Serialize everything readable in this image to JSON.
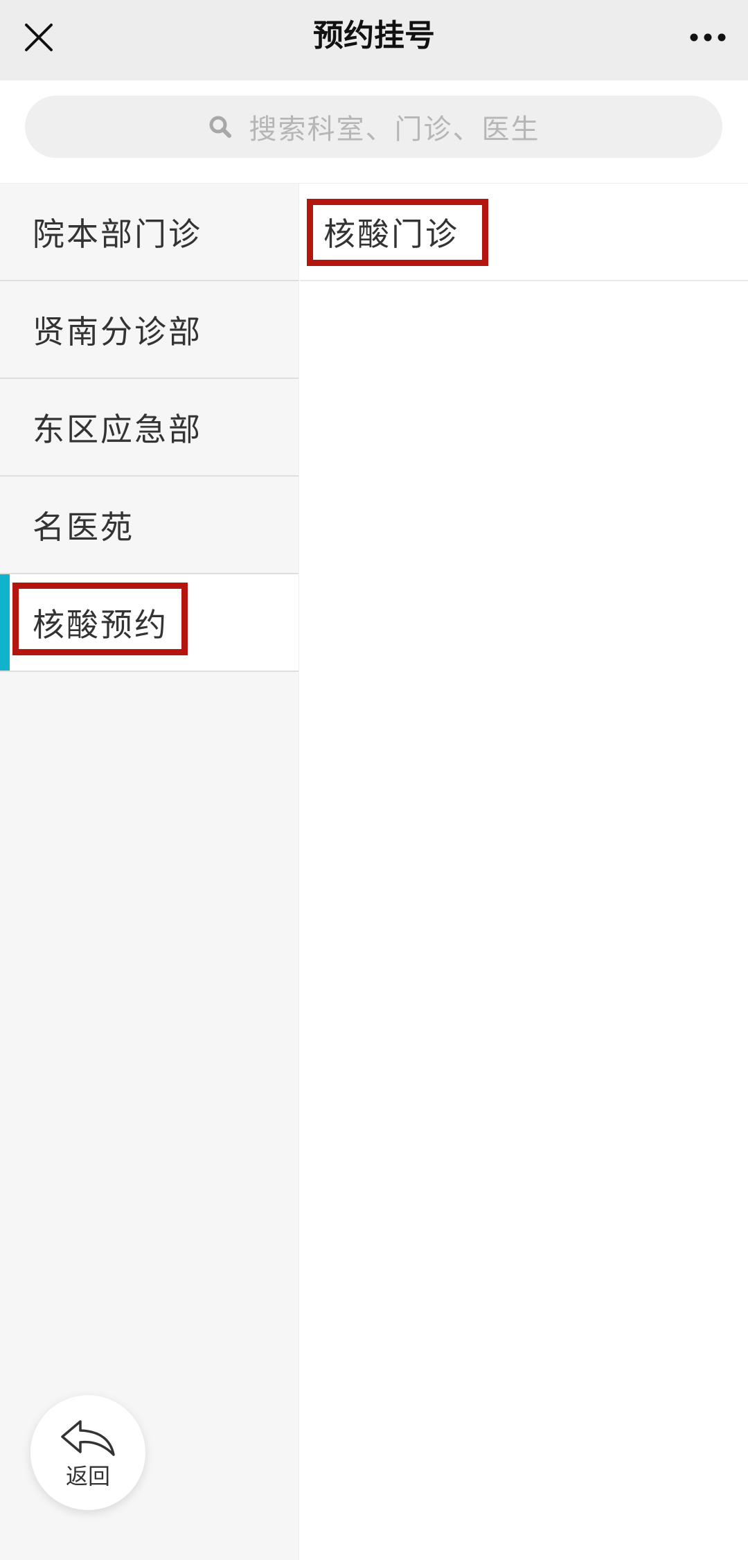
{
  "header": {
    "title": "预约挂号",
    "close_icon": "close-icon",
    "more_icon": "more-dots-icon"
  },
  "search": {
    "placeholder": "搜索科室、门诊、医生",
    "icon": "search-icon"
  },
  "sidebar": {
    "items": [
      {
        "label": "院本部门诊",
        "active": false
      },
      {
        "label": "贤南分诊部",
        "active": false
      },
      {
        "label": "东区应急部",
        "active": false
      },
      {
        "label": "名医苑",
        "active": false
      },
      {
        "label": "核酸预约",
        "active": true,
        "highlighted": true
      }
    ],
    "active_color": "#11b3cc"
  },
  "main": {
    "items": [
      {
        "label": "核酸门诊",
        "highlighted": true
      }
    ]
  },
  "back_button": {
    "label": "返回",
    "icon": "back-arrow-icon"
  },
  "colors": {
    "highlight": "#b5150f",
    "header_bg": "#ededed",
    "sidebar_bg": "#f6f6f6"
  }
}
